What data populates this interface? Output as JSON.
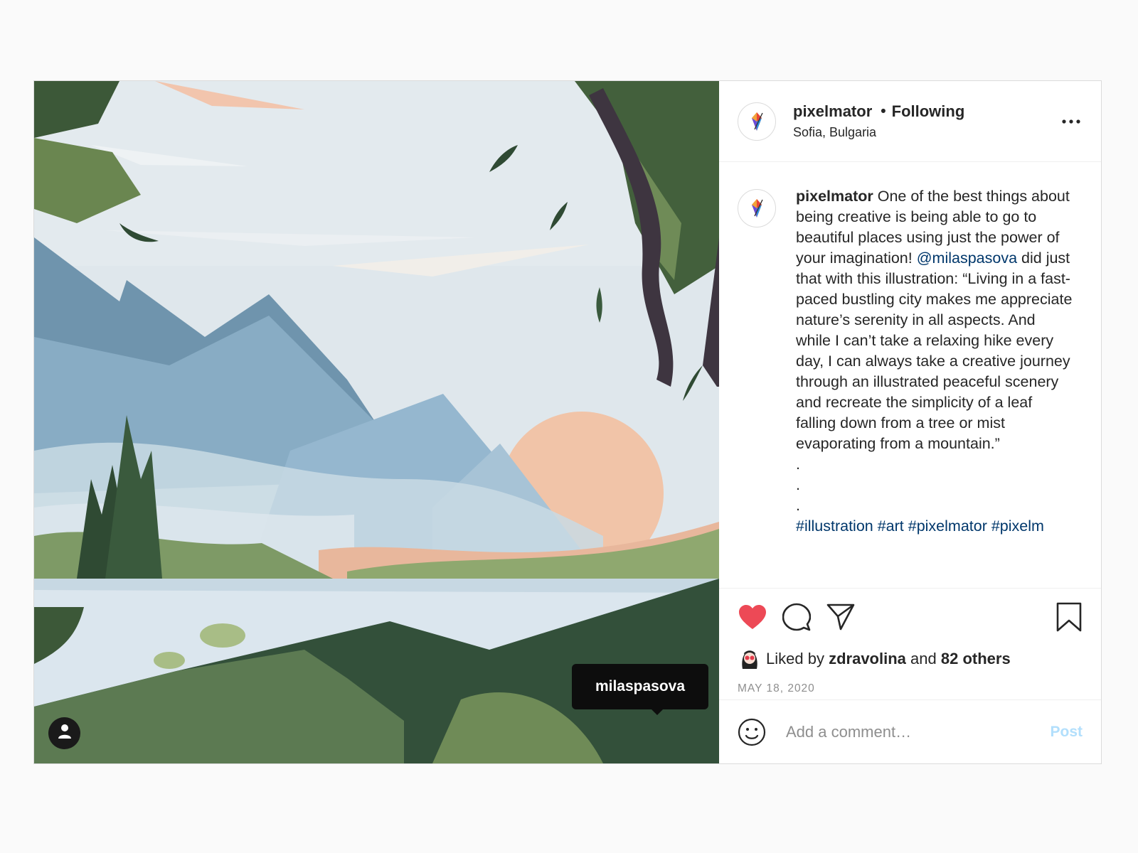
{
  "post": {
    "image_tag_user": "milaspasova",
    "header": {
      "username": "pixelmator",
      "separator": "•",
      "follow_status": "Following",
      "location": "Sofia, Bulgaria"
    },
    "caption": {
      "username": "pixelmator",
      "text_part1": "One of the best things about being creative is being able to go to beautiful places using just the power of your imagination!",
      "mention": "@milaspasova",
      "text_part2": "did just that with this illustration: “Living in a fast-paced bustling city makes me appreciate nature’s serenity in all aspects. And while I can’t take a relaxing hike every day, I can always take a creative journey through an illustrated peaceful scenery and recreate the simplicity of a leaf falling down from a tree or mist evaporating from a mountain.”",
      "dots": [
        ".",
        ".",
        "."
      ],
      "hashtags": "#illustration #art #pixelmator #pixelm"
    },
    "likes": {
      "prefix": "Liked by",
      "user": "zdravolina",
      "conjunction": "and",
      "others": "82 others"
    },
    "date": "MAY 18, 2020",
    "comment_box": {
      "placeholder": "Add a comment…",
      "post_label": "Post"
    },
    "icons": {
      "like": "heart-filled-icon",
      "comment": "speech-bubble-icon",
      "share": "paper-plane-icon",
      "save": "bookmark-icon",
      "more": "more-options-icon",
      "emoji": "smiley-icon",
      "user_tag": "person-icon"
    },
    "colors": {
      "like_red": "#ed4956",
      "link_blue": "#00376b",
      "post_button_disabled": "#b2dffc"
    }
  }
}
